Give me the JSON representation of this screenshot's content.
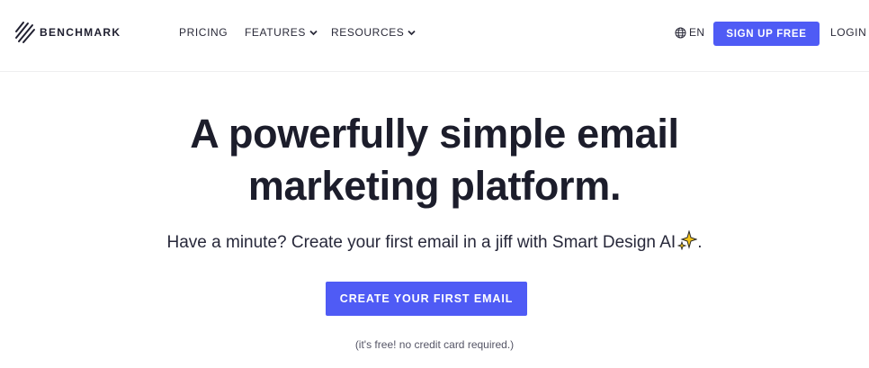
{
  "header": {
    "logo_text": "BENCHMARK",
    "nav": [
      {
        "label": "PRICING",
        "has_dropdown": false
      },
      {
        "label": "FEATURES",
        "has_dropdown": true
      },
      {
        "label": "RESOURCES",
        "has_dropdown": true
      }
    ],
    "language_label": "EN",
    "signup_label": "SIGN UP FREE",
    "login_label": "LOGIN"
  },
  "hero": {
    "title_line1": "A powerfully simple email",
    "title_line2": "marketing platform.",
    "subtitle": "Have a minute? Create your first email in a jiff with Smart Design AI",
    "subtitle_end": ".",
    "cta_label": "CREATE YOUR FIRST EMAIL",
    "note": "(it's free! no credit card required.)"
  },
  "colors": {
    "accent": "#4f5bf5",
    "text": "#1c1d2b",
    "sparkle": "#f5c518"
  },
  "icons": [
    "benchmark-logo-icon",
    "chevron-down-icon",
    "globe-icon",
    "sparkle-icon"
  ]
}
